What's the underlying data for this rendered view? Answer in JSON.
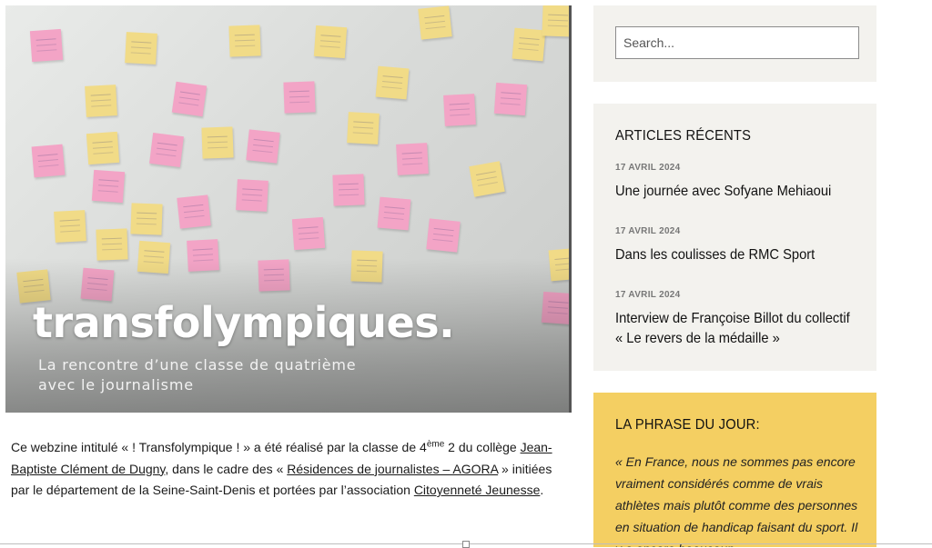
{
  "hero": {
    "title": "transfolympiques.",
    "subtitle_line1": "La rencontre d’une classe de quatrième",
    "subtitle_line2": "avec le journalisme"
  },
  "intro": {
    "part1": "Ce webzine intitulé « ! Transfolympique ! » a été réalisé par la classe de 4",
    "sup": "ème",
    "part2": " 2 du collège ",
    "link1": "Jean-Baptiste Clément de Dugny",
    "part3": ", dans le cadre des « ",
    "link2": "Résidences de journalistes – AGORA",
    "part4": " » initiées par le département de la Seine-Saint-Denis et portées par l’association ",
    "link3": "Citoyenneté Jeunesse",
    "part5": "."
  },
  "sidebar": {
    "search": {
      "placeholder": "Search..."
    },
    "recent": {
      "title": "ARTICLES RÉCENTS",
      "posts": [
        {
          "date": "17 AVRIL 2024",
          "title": "Une journée avec Sofyane Mehiaoui"
        },
        {
          "date": "17 AVRIL 2024",
          "title": "Dans les coulisses de RMC Sport"
        },
        {
          "date": "17 AVRIL 2024",
          "title": "Interview de Françoise Billot du collectif « Le revers de la médaille »"
        }
      ]
    },
    "quote": {
      "title": "LA PHRASE DU JOUR:",
      "text": "« En France, nous ne sommes pas encore vraiment considérés comme de vrais athlètes mais plutôt comme des personnes en situation de handicap faisant du sport. Il y a encore beaucoup"
    }
  },
  "colors": {
    "sidebar_bg": "#f3f2ee",
    "quote_bg": "#f4cf62",
    "note_yellow": "#f1db87",
    "note_pink": "#f3a4c6"
  }
}
